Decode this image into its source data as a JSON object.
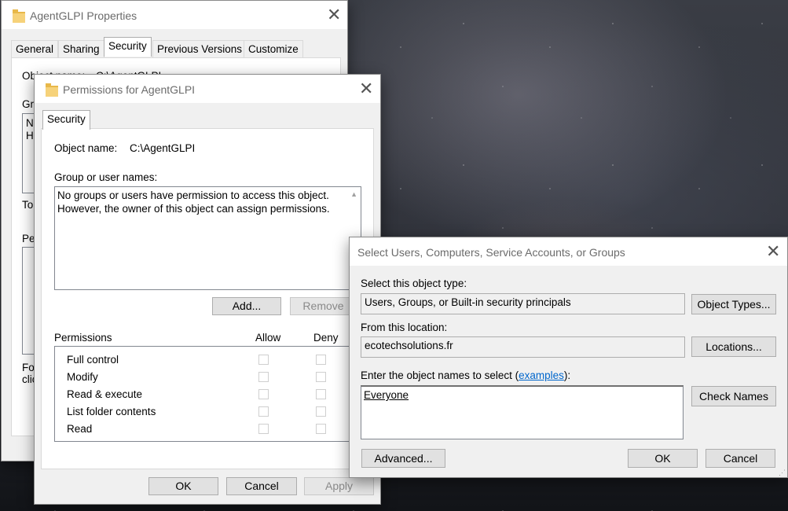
{
  "properties": {
    "title": "AgentGLPI Properties",
    "tabs": [
      "General",
      "Sharing",
      "Security",
      "Previous Versions",
      "Customize"
    ],
    "object_name_label": "Object name:",
    "object_name_value": "C:\\AgentGLPI",
    "group_label_partial": "Gro",
    "list_partial_1": "No",
    "list_partial_2": "Ho",
    "to_partial": "To",
    "perm_partial": "Pe",
    "for_partial_1": "For",
    "for_partial_2": "clic"
  },
  "permissions": {
    "title": "Permissions for AgentGLPI",
    "tab": "Security",
    "object_name_label": "Object name:",
    "object_name_value": "C:\\AgentGLPI",
    "group_label": "Group or user names:",
    "list_text_1": "No groups or users have permission to access this object.",
    "list_text_2": "However, the owner of this object can assign permissions.",
    "add_button": "Add...",
    "remove_button": "Remove",
    "permissions_label": "Permissions",
    "allow_label": "Allow",
    "deny_label": "Deny",
    "perm_rows": [
      "Full control",
      "Modify",
      "Read & execute",
      "List folder contents",
      "Read"
    ],
    "ok_button": "OK",
    "cancel_button": "Cancel",
    "apply_button": "Apply"
  },
  "select_dialog": {
    "title": "Select Users, Computers, Service Accounts, or Groups",
    "object_type_label": "Select this object type:",
    "object_type_value": "Users, Groups, or Built-in security principals",
    "object_types_button": "Object Types...",
    "location_label": "From this location:",
    "location_value": "ecotechsolutions.fr",
    "locations_button": "Locations...",
    "enter_label_prefix": "Enter the object names to select (",
    "enter_label_link": "examples",
    "enter_label_suffix": "):",
    "object_names_value": "Everyone",
    "check_names_button": "Check Names",
    "advanced_button": "Advanced...",
    "ok_button": "OK",
    "cancel_button": "Cancel"
  }
}
